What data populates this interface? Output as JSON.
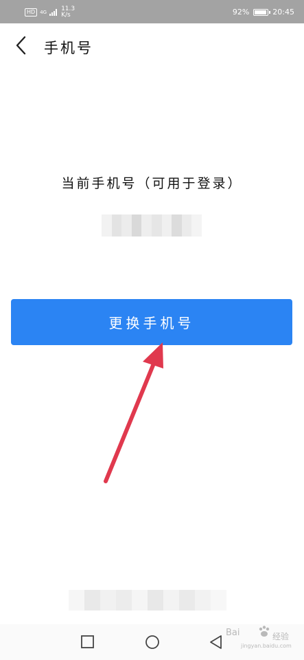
{
  "status_bar": {
    "hd": "HD",
    "network_type": "4G",
    "speed_value": "11.3",
    "speed_unit": "K/s",
    "battery_percent": "92%",
    "battery_level": 0.92,
    "time": "20:45"
  },
  "header": {
    "back_icon": "chevron-left-icon",
    "title": "手机号"
  },
  "main": {
    "current_phone_label": "当前手机号（可用于登录）",
    "phone_number_obscured": "",
    "change_button_label": "更换手机号"
  },
  "annotation": {
    "arrow_color": "#e0394e",
    "arrow_icon": "arrow-up-icon"
  },
  "nav_bar": {
    "recent_icon": "square-icon",
    "home_icon": "circle-icon",
    "back_icon": "triangle-back-icon"
  },
  "watermark": {
    "brand": "Bai",
    "product": "经验",
    "url": "jingyan.baidu.com"
  },
  "colors": {
    "status_bar": "#a3a3a3",
    "primary_button": "#2b84f3",
    "nav_bar": "#fafafa",
    "arrow": "#e0394e"
  }
}
